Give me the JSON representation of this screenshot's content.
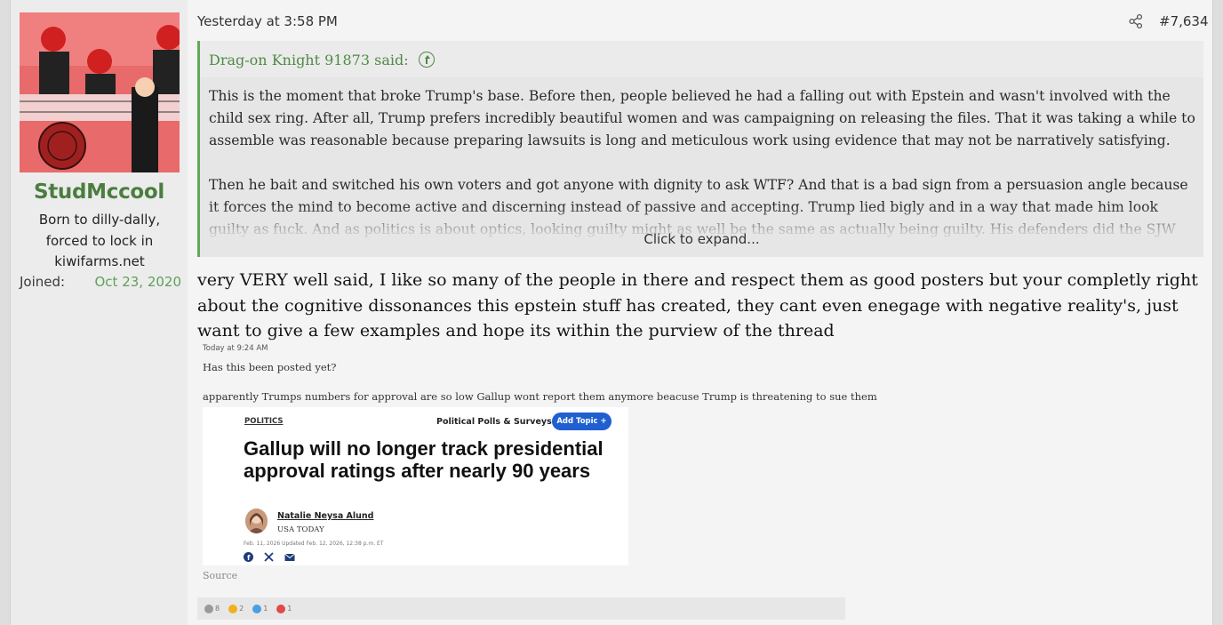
{
  "user": {
    "username": "StudMccool",
    "title": "Born to dilly-dally, forced to lock in kiwifarms.net",
    "joined_label": "Joined:",
    "joined_value": "Oct 23, 2020"
  },
  "post": {
    "date": "Yesterday at 3:58 PM",
    "number": "#7,634",
    "share_icon": "share-icon",
    "quote": {
      "author_said": "Drag-on Knight 91873 said:",
      "arrow_icon": "arrow-up-circle-icon",
      "paragraph1": "This is the moment that broke Trump's base. Before then, people believed he had a falling out with Epstein and wasn't involved with the child sex ring. After all, Trump prefers incredibly beautiful women and was campaigning on releasing the files. That it was taking a while to assemble was reasonable because preparing lawsuits is long and meticulous work using evidence that may not be narratively satisfying.",
      "paragraph2": "Then he bait and switched his own voters and got anyone with dignity to ask WTF? And that is a bad sign from a persuasion angle because it forces the mind to become active and discerning instead of passive and accepting. Trump lied bigly and in a way that made him look guilty as fuck. And as politics is about optics, looking guilty might as well be the same as actually being guilty. His defenders did the SJW",
      "expand_label": "Click to expand..."
    },
    "reply_text": "very VERY well said, I like so many of the people in there and respect them as good posters but your completly right about the cognitive dissonances this epstein stuff has created, they cant even enegage with negative reality's, just want to give a few examples and hope its within the purview of the thread"
  },
  "embed": {
    "time": "Today at 9:24 AM",
    "question": "Has this been posted yet?",
    "text": "apparently Trumps numbers for approval are so low Gallup wont report them anymore beacuse Trump is threatening to sue them",
    "article": {
      "section": "POLITICS",
      "category": "Political Polls & Surveys",
      "add_topic": "Add Topic +",
      "headline": "Gallup will no longer track presidential approval ratings after nearly 90 years",
      "author": "Natalie Neysa Alund",
      "outlet": "USA TODAY",
      "dates": "Feb. 11, 2026   Updated Feb. 12, 2026, 12:38 p.m. ET",
      "share_icons": [
        "facebook-icon",
        "x-icon",
        "mail-icon"
      ]
    },
    "source": "Source",
    "reactions": [
      {
        "icon": "thumb-icon",
        "count": "8",
        "color": "#9a9a9a"
      },
      {
        "icon": "thinking-icon",
        "count": "2",
        "color": "#f2b01e"
      },
      {
        "icon": "rainbow-icon",
        "count": "1",
        "color": "#4aa0e0"
      },
      {
        "icon": "clock-icon",
        "count": "1",
        "color": "#e04a4a"
      }
    ]
  }
}
